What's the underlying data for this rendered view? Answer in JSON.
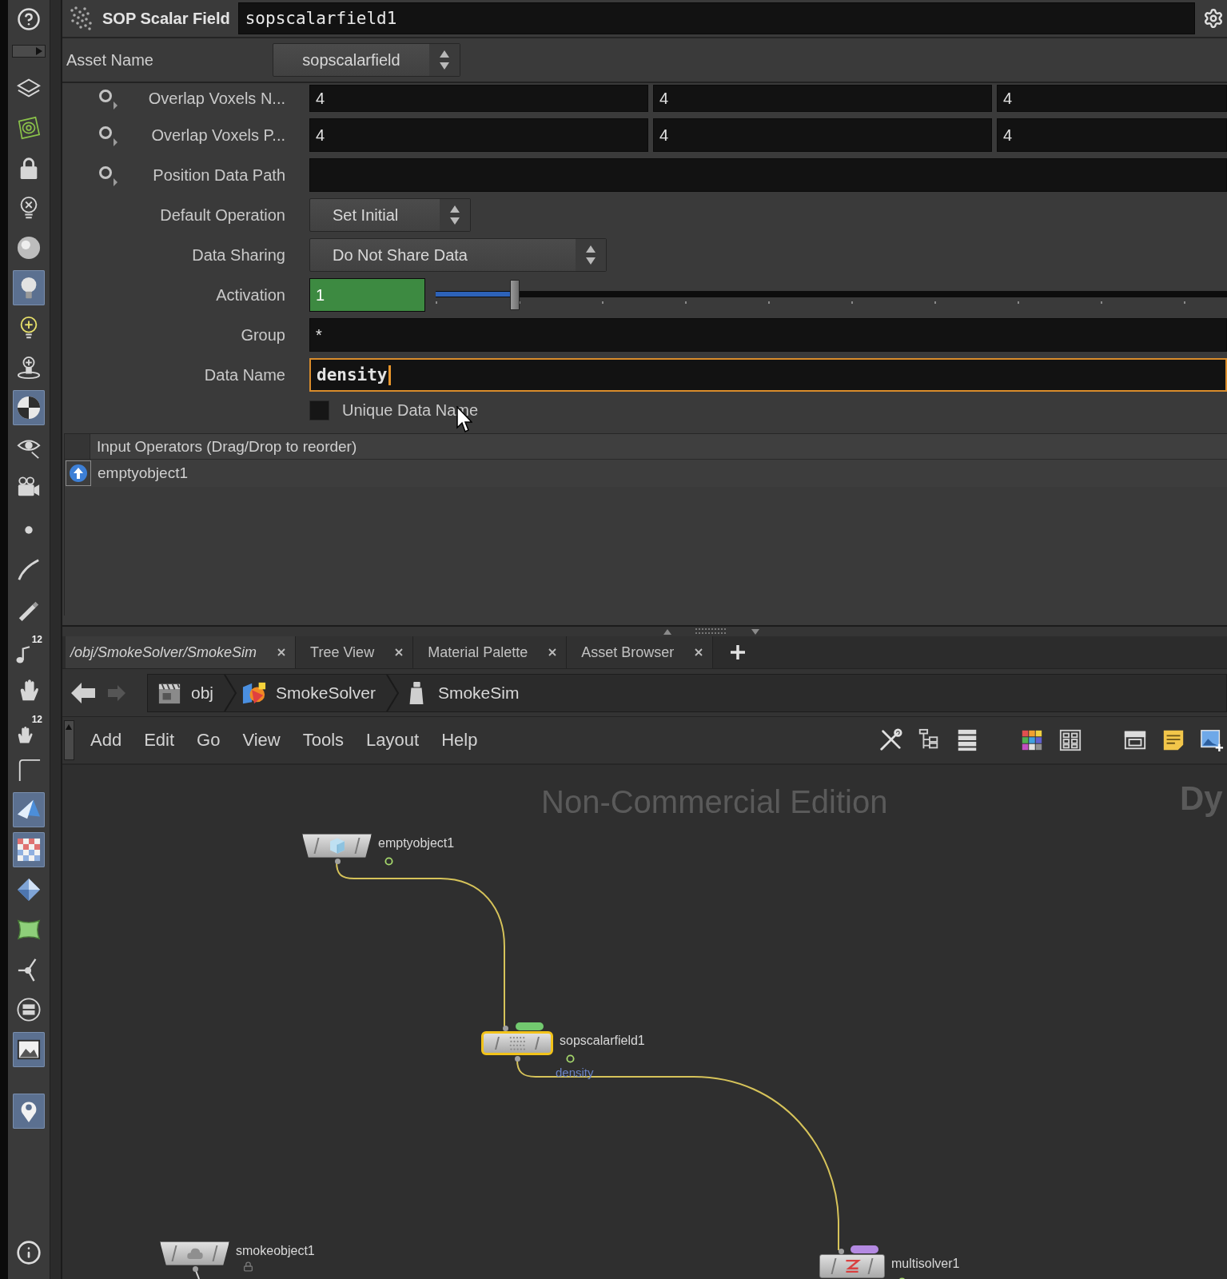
{
  "header": {
    "node_type": "SOP Scalar Field",
    "node_name": "sopscalarfield1"
  },
  "asset": {
    "label": "Asset Name",
    "value": "sopscalarfield"
  },
  "parameters": [
    {
      "kind": "vector",
      "label": "Overlap Voxels N...",
      "operation_menu": true,
      "values": [
        "4",
        "4",
        "4"
      ]
    },
    {
      "kind": "vector",
      "label": "Overlap Voxels P...",
      "operation_menu": true,
      "values": [
        "4",
        "4",
        "4"
      ]
    },
    {
      "kind": "text",
      "label": "Position Data Path",
      "operation_menu": true
    },
    {
      "kind": "menu",
      "label": "Default Operation",
      "value": "Set Initial"
    },
    {
      "kind": "menu",
      "label": "Data Sharing",
      "value": "Do Not Share Data"
    },
    {
      "kind": "slider",
      "label": "Activation",
      "value": "1",
      "keyed": true,
      "level": 0.1
    },
    {
      "kind": "text",
      "label": "Group",
      "value": "*"
    },
    {
      "kind": "text",
      "label": "Data Name",
      "value": "density",
      "focused": true
    },
    {
      "kind": "toggle",
      "label": "Unique Data Name",
      "checked": false
    }
  ],
  "input_operators": {
    "header": "Input Operators (Drag/Drop to reorder)",
    "items": [
      {
        "name": "emptyobject1"
      }
    ]
  },
  "tabs": [
    {
      "kind": "path",
      "label": "/obj/SmokeSolver/SmokeSim",
      "selected": true
    },
    {
      "kind": "pane",
      "label": "Tree View",
      "selected": false
    },
    {
      "kind": "pane",
      "label": "Material Palette",
      "selected": false
    },
    {
      "kind": "pane",
      "label": "Asset Browser",
      "selected": false
    }
  ],
  "path_bar": {
    "back_disabled": false,
    "forward_disabled": true,
    "crumbs": [
      "obj",
      "SmokeSolver",
      "SmokeSim"
    ]
  },
  "menu_bar": [
    "Add",
    "Edit",
    "Go",
    "View",
    "Tools",
    "Layout",
    "Help"
  ],
  "network": {
    "watermark": "Non-Commercial Edition",
    "context_label": "Dy",
    "nodes": [
      {
        "kind": "object",
        "name": "emptyobject1",
        "selected": false,
        "locked": false
      },
      {
        "kind": "dop",
        "name": "sopscalarfield1",
        "selected": true,
        "locked": false,
        "flag": {
          "color": "#72c96f"
        },
        "output_label": "density"
      },
      {
        "kind": "object",
        "name": "smokeobject1",
        "selected": false,
        "locked": true
      },
      {
        "kind": "dop",
        "name": "multisolver1",
        "selected": false,
        "locked": false,
        "flag": {
          "color": "#b48ae2"
        }
      }
    ]
  },
  "shelf": [
    {
      "on": false
    },
    {
      "on": false
    },
    {
      "on": false
    },
    {
      "on": false
    },
    {
      "on": false
    },
    {
      "on": true
    },
    {
      "on": false
    },
    {
      "on": false
    },
    {
      "on": true
    },
    {
      "on": false
    },
    {
      "on": false
    },
    {
      "on": false
    },
    {
      "on": false
    },
    {
      "on": false
    },
    {
      "on": false,
      "badge": "12"
    },
    {
      "on": false
    },
    {
      "on": false,
      "badge": "12"
    },
    {
      "on": false
    },
    {
      "on": true
    },
    {
      "on": true
    },
    {
      "on": false
    },
    {
      "on": false
    },
    {
      "on": false
    },
    {
      "on": false
    },
    {
      "on": true
    },
    {
      "on": true
    }
  ]
}
